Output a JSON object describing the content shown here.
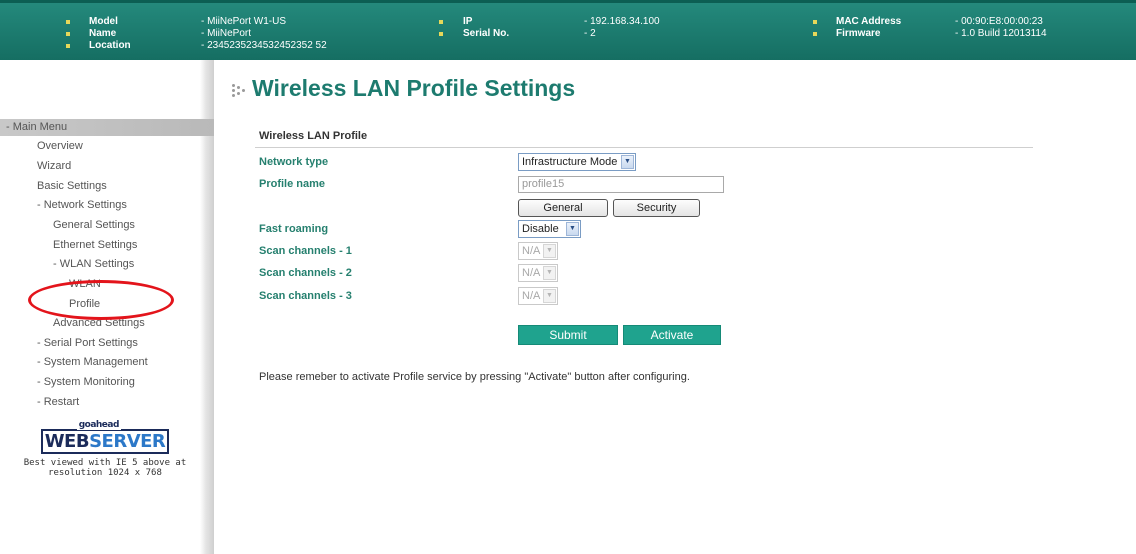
{
  "header": {
    "col1": [
      {
        "label": "Model",
        "value": "- MiiNePort W1-US"
      },
      {
        "label": "Name",
        "value": "- MiiNePort"
      },
      {
        "label": "Location",
        "value": "- 2345235234532452352 52"
      }
    ],
    "col2": [
      {
        "label": "IP",
        "value": "- 192.168.34.100"
      },
      {
        "label": "Serial No.",
        "value": "- 2"
      }
    ],
    "col3": [
      {
        "label": "MAC Address",
        "value": "- 00:90:E8:00:00:23"
      },
      {
        "label": "Firmware",
        "value": "- 1.0 Build 12013114"
      }
    ]
  },
  "sidebar": {
    "menu_title": "- Main Menu",
    "items": [
      "Overview",
      "Wizard",
      "Basic Settings",
      "- Network Settings",
      "General Settings",
      "Ethernet Settings",
      "- WLAN Settings",
      "WLAN",
      "Profile",
      "Advanced Settings",
      "- Serial Port Settings",
      "- System Management",
      "- System Monitoring",
      "- Restart"
    ],
    "logo_small": "goahead",
    "logo_web": "WEB",
    "logo_server": "SERVER",
    "best_viewed_1": "Best viewed with IE 5 above at",
    "best_viewed_2": "resolution 1024 x 768"
  },
  "page": {
    "title": "Wireless LAN Profile Settings",
    "section_title": "Wireless LAN Profile"
  },
  "form": {
    "network_type_label": "Network type",
    "network_type_value": "Infrastructure Mode",
    "profile_name_label": "Profile name",
    "profile_name_value": "profile15",
    "general_button": "General",
    "security_button": "Security",
    "fast_roaming_label": "Fast roaming",
    "fast_roaming_value": "Disable",
    "scan1_label": "Scan channels - 1",
    "scan1_value": "N/A",
    "scan2_label": "Scan channels - 2",
    "scan2_value": "N/A",
    "scan3_label": "Scan channels - 3",
    "scan3_value": "N/A",
    "submit_button": "Submit",
    "activate_button": "Activate",
    "note": "Please remeber to activate Profile service by pressing \"Activate\" button after configuring."
  },
  "colors": {
    "header_bg": "#1a7a6e",
    "title_green": "#1d7b6f",
    "label_green": "#26806f",
    "button_green": "#1fa38e",
    "highlight_red": "#e3141b"
  }
}
